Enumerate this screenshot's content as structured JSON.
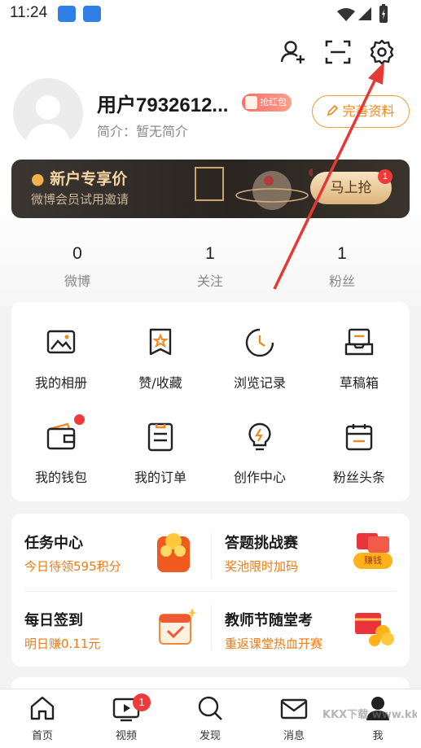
{
  "status_bar": {
    "time": "11:24"
  },
  "profile": {
    "username": "用户7932612...",
    "red_packet_label": "抢红包",
    "bio": "简介：暂无简介",
    "edit_button": "完善资料"
  },
  "banner": {
    "title": "新户专享价",
    "subtitle": "微博会员试用邀请",
    "button": "马上抢",
    "badge": "1"
  },
  "stats": [
    {
      "value": "0",
      "label": "微博"
    },
    {
      "value": "1",
      "label": "关注"
    },
    {
      "value": "1",
      "label": "粉丝"
    }
  ],
  "grid": [
    {
      "label": "我的相册",
      "icon": "photo-album-icon"
    },
    {
      "label": "赞/收藏",
      "icon": "like-collect-icon"
    },
    {
      "label": "浏览记录",
      "icon": "history-clock-icon"
    },
    {
      "label": "草稿箱",
      "icon": "drafts-icon"
    },
    {
      "label": "我的钱包",
      "icon": "wallet-icon"
    },
    {
      "label": "我的订单",
      "icon": "orders-icon"
    },
    {
      "label": "创作中心",
      "icon": "creator-bulb-icon"
    },
    {
      "label": "粉丝头条",
      "icon": "fans-headline-icon"
    }
  ],
  "tasks": [
    {
      "title": "任务中心",
      "subtitle": "今日待领595积分"
    },
    {
      "title": "答题挑战赛",
      "subtitle": "奖池限时加码",
      "chip": "赚钱"
    },
    {
      "title": "每日签到",
      "subtitle": "明日赚0.11元"
    },
    {
      "title": "教师节随堂考",
      "subtitle": "重返课堂热血开赛"
    }
  ],
  "tabbar": [
    {
      "label": "首页",
      "icon": "home-icon"
    },
    {
      "label": "视频",
      "icon": "video-icon",
      "badge": "1"
    },
    {
      "label": "发现",
      "icon": "discover-search-icon"
    },
    {
      "label": "消息",
      "icon": "message-mail-icon"
    },
    {
      "label": "我",
      "icon": "me-person-icon"
    }
  ],
  "watermark": "KKX下载 www.kkx.net",
  "colors": {
    "accent": "#f08a1e",
    "badge": "#f03a3a",
    "arrow": "#e53935"
  }
}
